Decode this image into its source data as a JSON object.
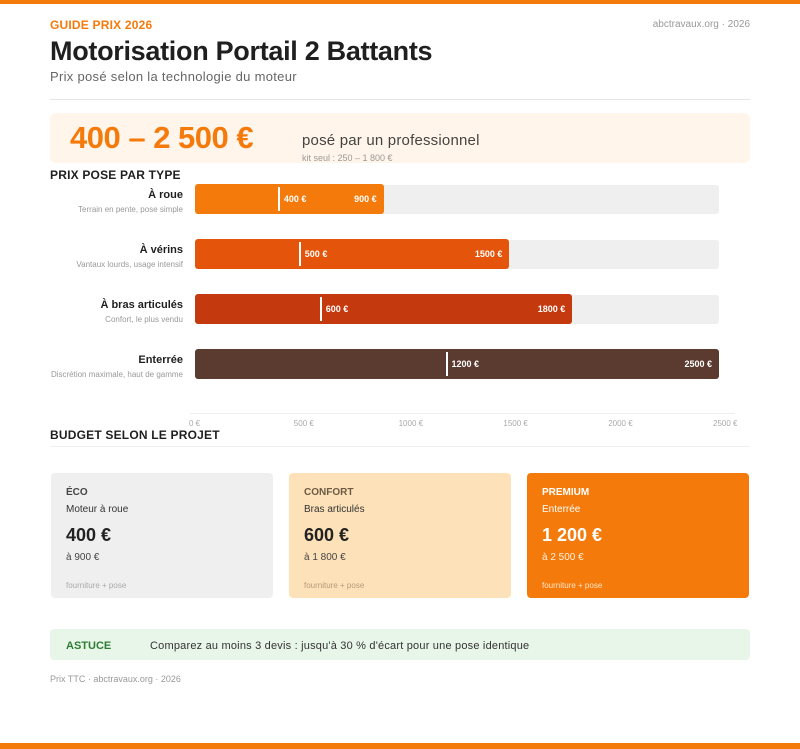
{
  "header": {
    "kicker": "GUIDE PRIX 2026",
    "site": "abctravaux.org · 2026",
    "title": "Motorisation Portail 2 Battants",
    "subtitle": "Prix posé selon la technologie du moteur"
  },
  "hero": {
    "range": "400 – 2 500 €",
    "note": "posé par un professionnel",
    "kit": "kit seul : 250 – 1 800 €"
  },
  "chart_data": {
    "type": "bar",
    "orientation": "horizontal",
    "title": "PRIX POSE PAR TYPE",
    "categories": [
      "À roue",
      "À vérins",
      "À bras articulés",
      "Enterrée"
    ],
    "descriptions": [
      "Terrain en pente, pose simple",
      "Vantaux lourds, usage intensif",
      "Confort, le plus vendu",
      "Discrétion maximale, haut de gamme"
    ],
    "min_values": [
      400,
      500,
      600,
      1200
    ],
    "max_values": [
      900,
      1500,
      1800,
      2500
    ],
    "min_labels": [
      "400 €",
      "500 €",
      "600 €",
      "1200 €"
    ],
    "max_labels": [
      "900 €",
      "1500 €",
      "1800 €",
      "2500 €"
    ],
    "colors": [
      "#f47b0b",
      "#e4540a",
      "#c5390f",
      "#5b3a2f"
    ],
    "xlim": [
      0,
      2500
    ],
    "ticks": [
      0,
      500,
      1000,
      1500,
      2000,
      2500
    ],
    "tick_labels": [
      "0 €",
      "500 €",
      "1000 €",
      "1500 €",
      "2000 €",
      "2500 €"
    ]
  },
  "budget": {
    "title": "BUDGET SELON LE PROJET",
    "cards": [
      {
        "title": "ÉCO",
        "sub": "Moteur à roue",
        "price": "400 €",
        "to": "à 900 €",
        "foot": "fourniture + pose"
      },
      {
        "title": "CONFORT",
        "sub": "Bras articulés",
        "price": "600 €",
        "to": "à 1 800 €",
        "foot": "fourniture + pose"
      },
      {
        "title": "PREMIUM",
        "sub": "Enterrée",
        "price": "1 200 €",
        "to": "à 2 500 €",
        "foot": "fourniture + pose"
      }
    ]
  },
  "tip": {
    "label": "ASTUCE",
    "text": "Comparez au moins 3 devis : jusqu'à 30 % d'écart pour une pose identique"
  },
  "footer": "Prix TTC · abctravaux.org · 2026",
  "colors": {
    "accent": "#f47b0b",
    "card_eco": "#efefef",
    "card_confort": "#fde1b9",
    "card_premium": "#f47b0b",
    "tip_bg": "#e8f5e9",
    "tip_text": "#2e7d32"
  }
}
